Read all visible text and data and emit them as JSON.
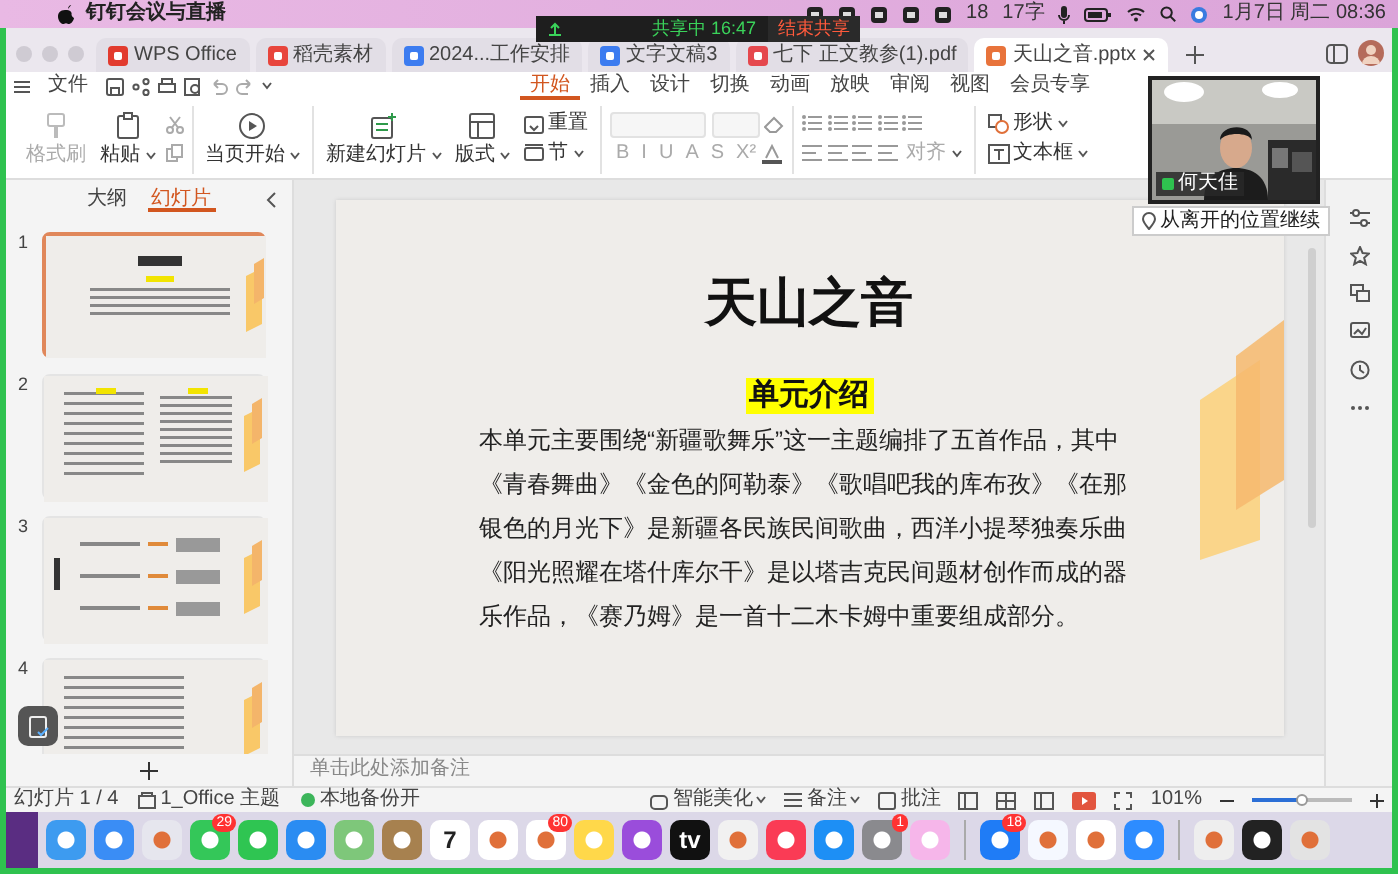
{
  "menubar": {
    "app_name": "钉钉会议与直播",
    "badge_count": "18",
    "word_count": "17字",
    "clock": "1月7日 周二 08:36"
  },
  "sharing_bar": {
    "status": "共享中 16:47",
    "stop_button": "结束共享"
  },
  "tabs": [
    {
      "label": "WPS Office",
      "kind": "home",
      "selected": false
    },
    {
      "label": "稻壳素材",
      "kind": "docer",
      "selected": false
    },
    {
      "label": "2024...工作安排",
      "kind": "word",
      "selected": false
    },
    {
      "label": "文字文稿3",
      "kind": "word",
      "selected": false
    },
    {
      "label": "七下 正文教参(1).pdf",
      "kind": "pdf",
      "selected": false
    },
    {
      "label": "天山之音.pptx",
      "kind": "ppt",
      "selected": true
    }
  ],
  "menu": {
    "file": "文件"
  },
  "ribbon_tabs": [
    {
      "label": "开始",
      "selected": true
    },
    {
      "label": "插入",
      "selected": false
    },
    {
      "label": "设计",
      "selected": false
    },
    {
      "label": "切换",
      "selected": false
    },
    {
      "label": "动画",
      "selected": false
    },
    {
      "label": "放映",
      "selected": false
    },
    {
      "label": "审阅",
      "selected": false
    },
    {
      "label": "视图",
      "selected": false
    },
    {
      "label": "会员专享",
      "selected": false
    }
  ],
  "ribbon": {
    "format_painter": {
      "label": "格式刷",
      "disabled": true
    },
    "paste": {
      "label": "粘贴",
      "disabled": false
    },
    "play_from_current": "当页开始",
    "new_slide": "新建幻灯片",
    "layout": "版式",
    "reset": "重置",
    "section": "节",
    "font_group": {
      "disabled": true,
      "buttons": [
        "B",
        "I",
        "U",
        "A",
        "S",
        "X²"
      ]
    },
    "align": "对齐",
    "shape": "形状",
    "text_box": "文本框"
  },
  "panel_tabs": [
    {
      "label": "大纲",
      "selected": false
    },
    {
      "label": "幻灯片",
      "selected": true
    }
  ],
  "thumbnails": [
    {
      "number": "1",
      "selected": true
    },
    {
      "number": "2",
      "selected": false
    },
    {
      "number": "3",
      "selected": false
    },
    {
      "number": "4",
      "selected": false
    }
  ],
  "slide": {
    "title": "天山之音",
    "heading": "单元介绍",
    "body": "本单元主要围绕“新疆歌舞乐”这一主题编排了五首作品，其中《青春舞曲》《金色的阿勒泰》《歌唱吧我的库布孜》《在那银色的月光下》是新疆各民族民间歌曲，西洋小提琴独奏乐曲《阳光照耀在塔什库尔干》是以塔吉克民间题材创作而成的器乐作品，《赛乃姆》是一首十二木卡姆中重要组成部分。"
  },
  "notes_placeholder": "单击此处添加备注",
  "video": {
    "participant": "何天佳",
    "resume_button": "从离开的位置继续"
  },
  "status_bar": {
    "slide_counter": "幻灯片 1 / 4",
    "theme": "1_Office 主题",
    "backup": "本地备份开",
    "beautify": "智能美化",
    "notes": "备注",
    "comments": "批注",
    "zoom": "101%",
    "zoom_slider": {
      "level": 0.5
    }
  },
  "dock": [
    {
      "kind": "finder"
    },
    {
      "kind": "mail"
    },
    {
      "kind": "launchpad"
    },
    {
      "kind": "messages",
      "badge": "29"
    },
    {
      "kind": "facetime"
    },
    {
      "kind": "safari"
    },
    {
      "kind": "maps"
    },
    {
      "kind": "contacts"
    },
    {
      "kind": "calendar",
      "label": "7"
    },
    {
      "kind": "reminders"
    },
    {
      "kind": "photos",
      "badge": "80"
    },
    {
      "kind": "notes"
    },
    {
      "kind": "podcasts"
    },
    {
      "kind": "tv",
      "label": "tv"
    },
    {
      "kind": "numbers"
    },
    {
      "kind": "music"
    },
    {
      "kind": "appstore"
    },
    {
      "kind": "settings",
      "badge": "1"
    },
    {
      "kind": "cleaner"
    },
    {
      "kind": "separator"
    },
    {
      "kind": "dingtalk",
      "badge": "18"
    },
    {
      "kind": "lark"
    },
    {
      "kind": "wps"
    },
    {
      "kind": "zoom"
    },
    {
      "kind": "separator"
    },
    {
      "kind": "help"
    },
    {
      "kind": "screen"
    },
    {
      "kind": "trash"
    }
  ]
}
